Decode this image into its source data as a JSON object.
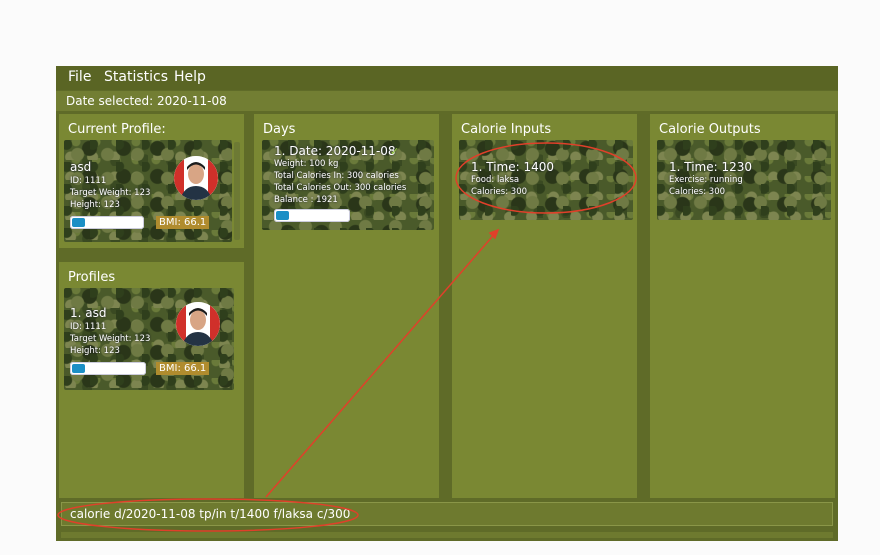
{
  "menu": {
    "file": "File",
    "statistics": "Statistics",
    "help": "Help"
  },
  "date_selected": "Date selected: 2020-11-08",
  "current_profile": {
    "title": "Current Profile:",
    "name": "asd",
    "id": "ID: 1111",
    "target_weight": "Target Weight: 123",
    "height": "Height: 123",
    "progress": 0.18,
    "bmi": "BMI: 66.1"
  },
  "profiles": {
    "title": "Profiles",
    "items": [
      {
        "name": "1.  asd",
        "id": "ID: 1111",
        "target_weight": "Target Weight: 123",
        "height": "Height: 123",
        "progress": 0.18,
        "bmi": "BMI: 66.1"
      }
    ]
  },
  "days": {
    "title": "Days",
    "items": [
      {
        "date": "1.  Date: 2020-11-08",
        "check": "✓",
        "weight": "Weight: 100 kg",
        "cal_in": "Total Calories In: 300 calories",
        "cal_out": "Total Calories Out: 300 calories",
        "balance": "Balance : 1921",
        "progress": 0.18
      }
    ]
  },
  "calorie_inputs": {
    "title": "Calorie Inputs",
    "items": [
      {
        "time": "1.  Time: 1400",
        "food": "Food: laksa",
        "calories": "Calories: 300"
      }
    ]
  },
  "calorie_outputs": {
    "title": "Calorie Outputs",
    "items": [
      {
        "time": "1.  Time: 1230",
        "exercise": "Exercise: running",
        "calories": "Calories: 300"
      }
    ]
  },
  "command": "calorie d/2020-11-08 tp/in t/1400 f/laksa c/300",
  "colors": {
    "app_bg": "#5f6b28",
    "panel": "#7a8833",
    "annotation": "#e0402a",
    "bar_fill": "#1b8fc5"
  }
}
